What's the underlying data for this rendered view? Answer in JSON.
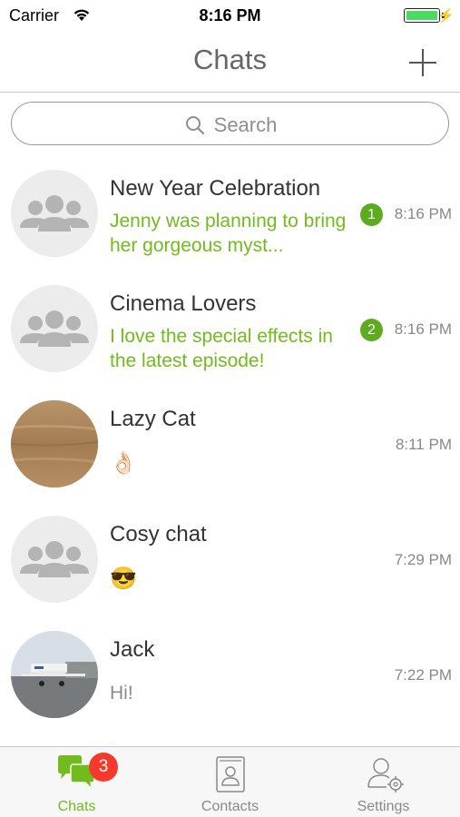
{
  "status_bar": {
    "carrier": "Carrier",
    "time": "8:16 PM"
  },
  "nav": {
    "title": "Chats"
  },
  "search": {
    "placeholder": "Search"
  },
  "chats": [
    {
      "name": "New Year Celebration",
      "preview": "Jenny was planning to bring her gorgeous myst...",
      "time": "8:16 PM",
      "unread": "1"
    },
    {
      "name": "Cinema Lovers",
      "preview": "I love the special effects in the latest episode!",
      "time": "8:16 PM",
      "unread": "2"
    },
    {
      "name": "Lazy Cat",
      "preview": "👌🏻",
      "time": "8:11 PM"
    },
    {
      "name": "Cosy chat",
      "preview": "😎",
      "time": "7:29 PM"
    },
    {
      "name": "Jack",
      "preview": "Hi!",
      "time": "7:22 PM"
    }
  ],
  "tabs": [
    {
      "label": "Chats",
      "badge": "3"
    },
    {
      "label": "Contacts"
    },
    {
      "label": "Settings"
    }
  ],
  "colors": {
    "accent": "#72bb1c",
    "badge_red": "#f5392d",
    "battery": "#4cd964"
  },
  "icons": [
    "wifi-icon",
    "battery-icon",
    "plus-icon",
    "search-icon",
    "group-avatar-icon",
    "chat-bubbles-icon",
    "contacts-book-icon",
    "settings-user-gear-icon"
  ]
}
